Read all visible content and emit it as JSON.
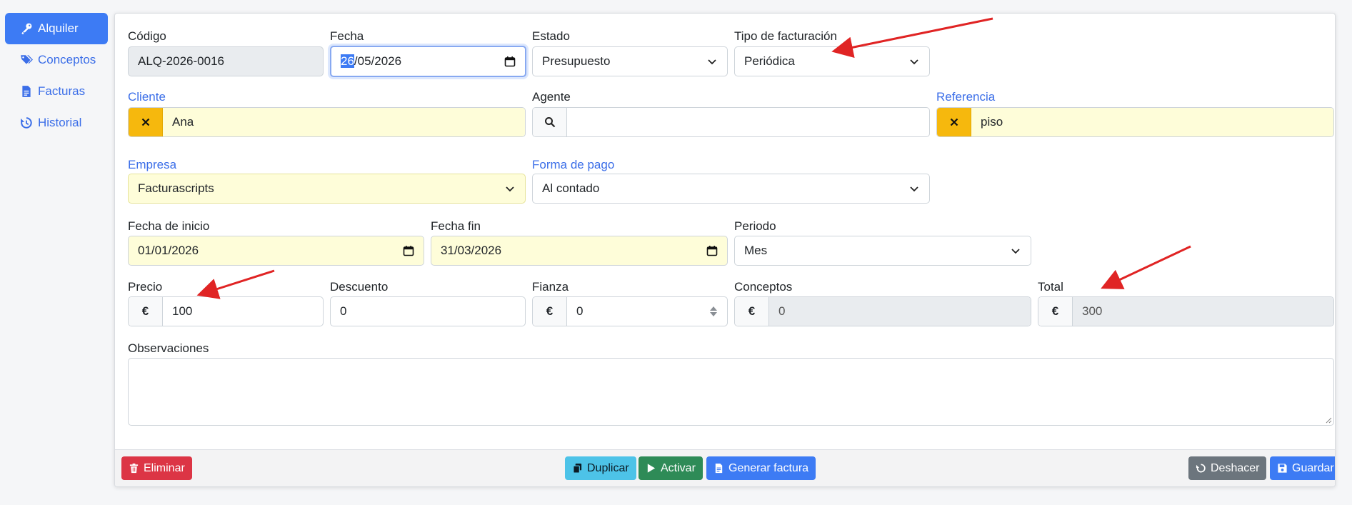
{
  "sidebar": {
    "items": [
      {
        "label": "Alquiler",
        "icon": "key-icon",
        "active": true
      },
      {
        "label": "Conceptos",
        "icon": "tags-icon",
        "active": false
      },
      {
        "label": "Facturas",
        "icon": "invoice-file-icon",
        "active": false
      },
      {
        "label": "Historial",
        "icon": "history-icon",
        "active": false
      }
    ]
  },
  "form": {
    "codigo": {
      "label": "Código",
      "value": "ALQ-2026-0016"
    },
    "fecha": {
      "label": "Fecha",
      "selected_part": "26",
      "rest": "/05/2026"
    },
    "estado": {
      "label": "Estado",
      "value": "Presupuesto"
    },
    "tipo": {
      "label": "Tipo de facturación",
      "value": "Periódica"
    },
    "cliente": {
      "label": "Cliente",
      "value": "Ana"
    },
    "agente": {
      "label": "Agente",
      "value": ""
    },
    "referencia": {
      "label": "Referencia",
      "value": "piso"
    },
    "empresa": {
      "label": "Empresa",
      "value": "Facturascripts"
    },
    "forma_pago": {
      "label": "Forma de pago",
      "value": "Al contado"
    },
    "fecha_inicio": {
      "label": "Fecha de inicio",
      "value": "01/01/2026"
    },
    "fecha_fin": {
      "label": "Fecha fin",
      "value": "31/03/2026"
    },
    "periodo": {
      "label": "Periodo",
      "value": "Mes"
    },
    "precio": {
      "label": "Precio",
      "currency": "€",
      "value": "100"
    },
    "descuento": {
      "label": "Descuento",
      "value": "0"
    },
    "fianza": {
      "label": "Fianza",
      "currency": "€",
      "value": "0"
    },
    "conceptos": {
      "label": "Conceptos",
      "currency": "€",
      "value": "0"
    },
    "total": {
      "label": "Total",
      "currency": "€",
      "value": "300"
    },
    "observaciones": {
      "label": "Observaciones",
      "value": ""
    }
  },
  "footer": {
    "eliminar": "Eliminar",
    "duplicar": "Duplicar",
    "activar": "Activar",
    "generar": "Generar factura",
    "deshacer": "Deshacer",
    "guardar": "Guardar"
  },
  "colors": {
    "primary": "#3d7bf4",
    "danger": "#dc3545",
    "info": "#4dc3e8",
    "success": "#2e8b57",
    "secondary": "#6c757d",
    "warning": "#f6b80d",
    "highlight": "#fefdd9",
    "annotation": "#e02424"
  }
}
